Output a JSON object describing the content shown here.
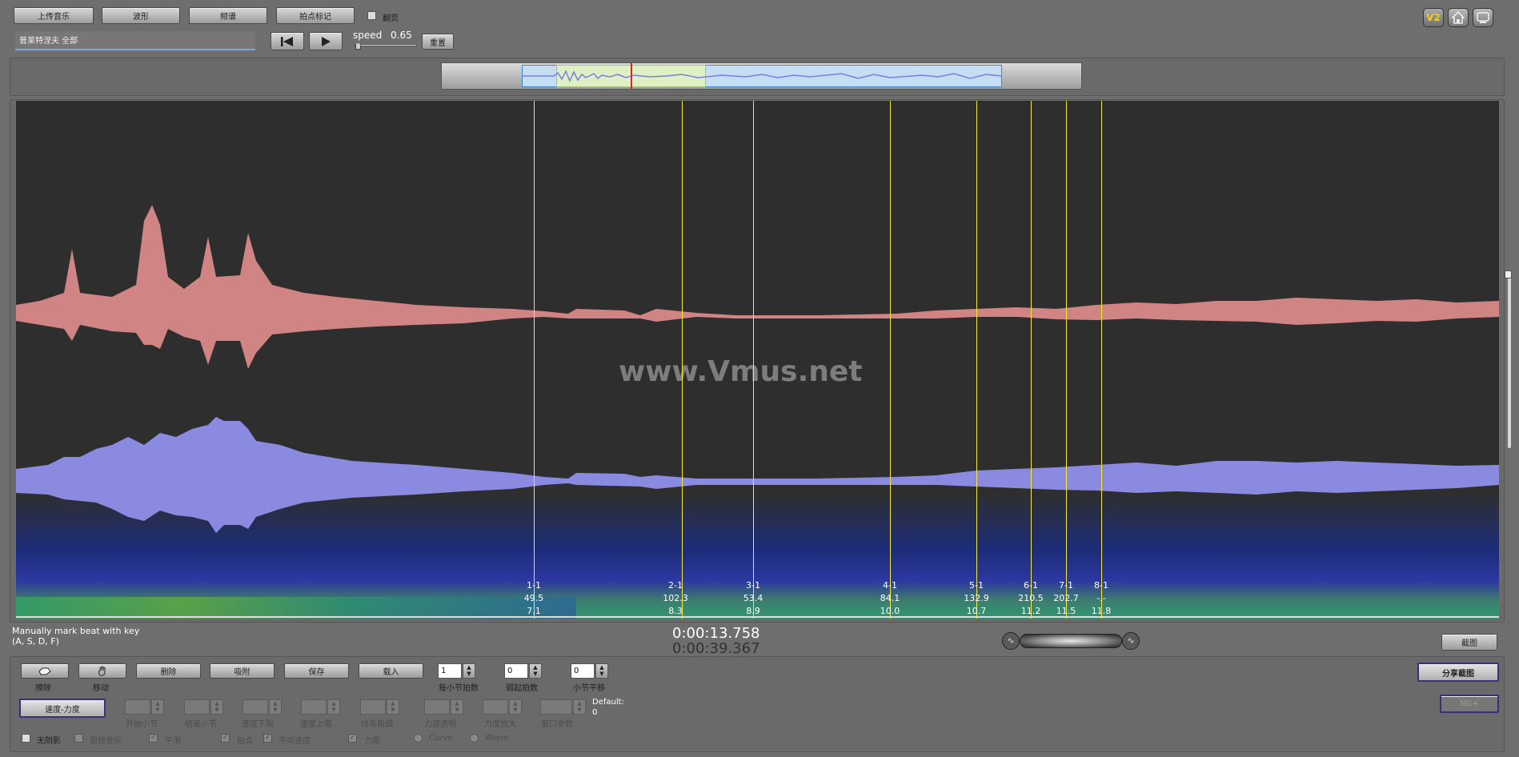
{
  "toolbar": {
    "upload_label": "上传音乐",
    "waveform_label": "波形",
    "spectrum_label": "频谱",
    "beatmark_label": "拍点标记",
    "flip_label": "翻页",
    "file_name": "普莱特涅夫 全部",
    "speed_label": "speed",
    "speed_value": "0.65",
    "reset_label": "重置"
  },
  "version_badge": "V2",
  "watermark": "www.Vmus.net",
  "beats": [
    {
      "label": "1-1",
      "val1": "49.5",
      "val2": "7.1"
    },
    {
      "label": "2-1",
      "val1": "102.3",
      "val2": "8.3"
    },
    {
      "label": "3-1",
      "val1": "53.4",
      "val2": "8.9"
    },
    {
      "label": "4-1",
      "val1": "84.1",
      "val2": "10.0"
    },
    {
      "label": "5-1",
      "val1": "132.9",
      "val2": "10.7"
    },
    {
      "label": "6-1",
      "val1": "210.5",
      "val2": "11.2"
    },
    {
      "label": "7-1",
      "val1": "202.7",
      "val2": "11.5"
    },
    {
      "label": "8-1",
      "val1": "-.-",
      "val2": "11.8"
    }
  ],
  "status": {
    "hint_line1": "Manually mark beat with key",
    "hint_line2": "(A, S, D, F)",
    "current_time": "0:00:13.758",
    "total_time": "0:00:39.367",
    "screenshot_label": "截图"
  },
  "editor": {
    "erase_label": "擦除",
    "move_label": "移动",
    "delete_label": "删除",
    "snap_label": "吸附",
    "save_label": "保存",
    "load_label": "载入",
    "beats_per_bar_value": "1",
    "beats_per_bar_label": "每小节拍数",
    "pickup_value": "0",
    "pickup_label": "弱起拍数",
    "bar_shift_value": "0",
    "bar_shift_label": "小节平移",
    "tempo_dynamics_label": "速度-力度",
    "start_bar_label": "开始小节",
    "end_bar_label": "结束小节",
    "tempo_min_label": "速度下限",
    "tempo_max_label": "速度上限",
    "line_thickness_label": "线条粗细",
    "dyn_transparency_label": "力度透明",
    "dyn_zoom_label": "力度放大",
    "window_param_label": "窗口参数",
    "default_label": "Default:",
    "default_value": "0",
    "share_label": "分享截图",
    "disabled_btn_label": "NG+"
  },
  "options": {
    "no_shade_label": "无阴影",
    "follow_music_label": "跟随音乐",
    "smooth_label": "平滑",
    "beat_label": "拍点",
    "avg_tempo_label": "平均速度",
    "dynamics_label": "力度",
    "curve_label": "Curve",
    "worm_label": "Worm"
  }
}
